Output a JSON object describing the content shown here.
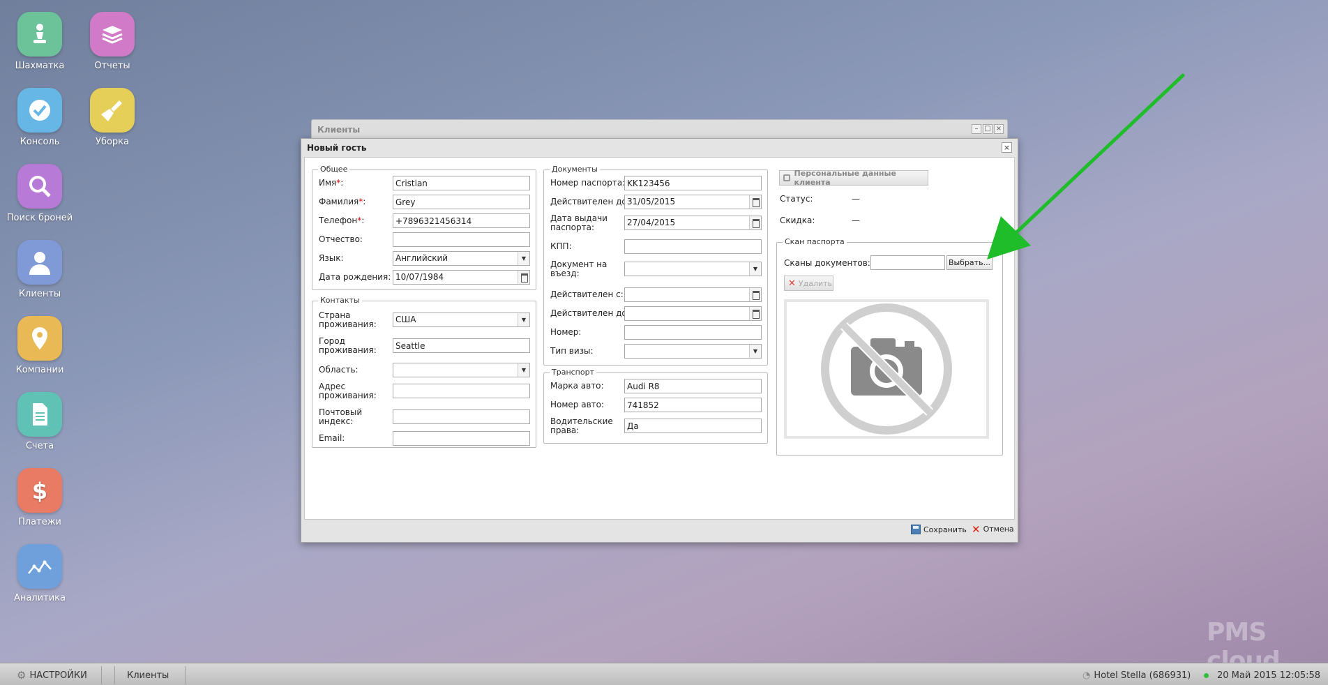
{
  "desktop": {
    "icons": [
      {
        "label": "Шахматка",
        "icon": "pawn-icon"
      },
      {
        "label": "Отчеты",
        "icon": "books-icon"
      },
      {
        "label": "Консоль",
        "icon": "check-icon"
      },
      {
        "label": "Уборка",
        "icon": "broom-icon"
      },
      {
        "label": "Поиск броней",
        "icon": "magnifier-icon"
      },
      {
        "label": "Клиенты",
        "icon": "person-icon"
      },
      {
        "label": "Компании",
        "icon": "location-pin-icon"
      },
      {
        "label": "Счета",
        "icon": "document-icon"
      },
      {
        "label": "Платежи",
        "icon": "dollar-icon"
      },
      {
        "label": "Аналитика",
        "icon": "chart-icon"
      }
    ]
  },
  "back_window": {
    "title": "Клиенты"
  },
  "dialog": {
    "title": "Новый гость",
    "general": {
      "legend": "Общее",
      "first_name": {
        "label": "Имя",
        "value": "Cristian"
      },
      "last_name": {
        "label": "Фамилия",
        "value": "Grey"
      },
      "phone": {
        "label": "Телефон",
        "value": "+7896321456314"
      },
      "patronymic": {
        "label": "Отчество:",
        "value": ""
      },
      "language": {
        "label": "Язык:",
        "value": "Английский"
      },
      "birthdate": {
        "label": "Дата рождения:",
        "value": "10/07/1984"
      }
    },
    "contacts": {
      "legend": "Контакты",
      "country": {
        "label": "Страна проживания:",
        "value": "США"
      },
      "city": {
        "label": "Город проживания:",
        "value": "Seattle"
      },
      "region": {
        "label": "Область:",
        "value": ""
      },
      "address": {
        "label": "Адрес проживания:",
        "value": ""
      },
      "postal": {
        "label": "Почтовый индекс:",
        "value": ""
      },
      "email": {
        "label": "Email:",
        "value": ""
      }
    },
    "documents": {
      "legend": "Документы",
      "passport_no": {
        "label": "Номер паспорта:",
        "value": "KK123456"
      },
      "valid_until": {
        "label": "Действителен до:",
        "value": "31/05/2015"
      },
      "issue_date": {
        "label": "Дата выдачи паспорта:",
        "value": "27/04/2015"
      },
      "kpp": {
        "label": "КПП:",
        "value": ""
      },
      "entry_doc": {
        "label": "Документ на въезд:",
        "value": ""
      },
      "valid_from": {
        "label": "Действителен с:",
        "value": ""
      },
      "valid_until2": {
        "label": "Действителен до:",
        "value": ""
      },
      "number": {
        "label": "Номер:",
        "value": ""
      },
      "visa_type": {
        "label": "Тип визы:",
        "value": ""
      }
    },
    "transport": {
      "legend": "Транспорт",
      "car_brand": {
        "label": "Марка авто:",
        "value": "Audi R8"
      },
      "car_number": {
        "label": "Номер авто:",
        "value": "741852"
      },
      "license": {
        "label": "Водительские права:",
        "value": "Да"
      }
    },
    "client": {
      "personal_data_button": "Персональные данные клиента",
      "status_label": "Статус:",
      "status_value": "—",
      "discount_label": "Скидка:",
      "discount_value": "—"
    },
    "scan": {
      "legend": "Скан паспорта",
      "docs_label": "Сканы документов:",
      "choose_button": "Выбрать...",
      "delete_button": "Удалить"
    },
    "footer": {
      "save": "Сохранить",
      "cancel": "Отмена"
    }
  },
  "taskbar": {
    "settings": "НАСТРОЙКИ",
    "task": "Клиенты",
    "hotel": "Hotel Stella (686931)",
    "datetime": "20 Май 2015 12:05:58"
  },
  "watermark": {
    "brand": "PMS cloud"
  },
  "colors": {
    "arrow": "#1fbd2a"
  }
}
